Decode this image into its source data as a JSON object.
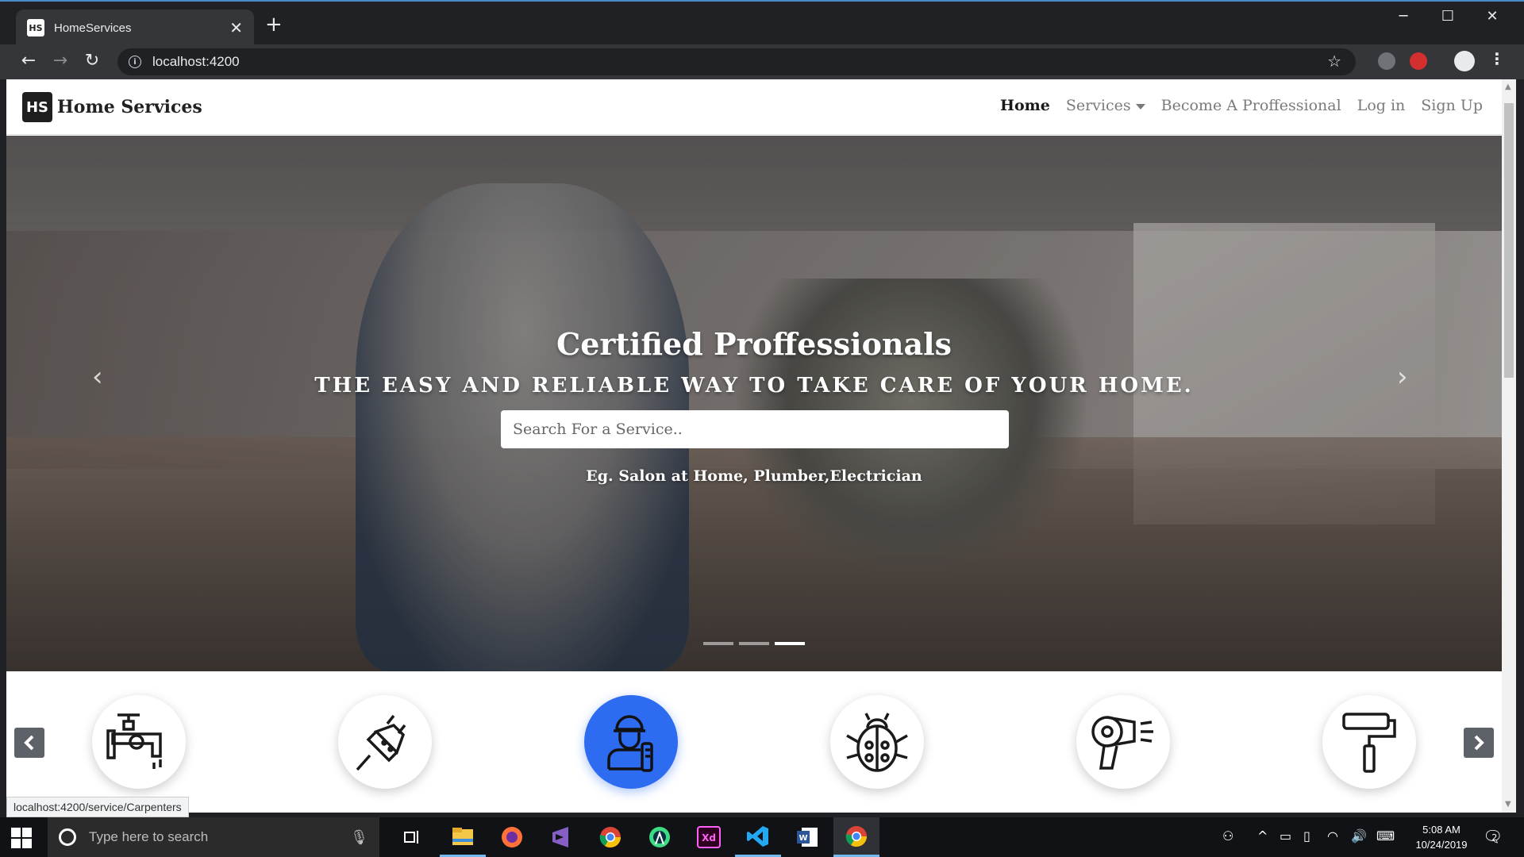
{
  "browser": {
    "tab_favicon": "HS",
    "tab_title": "HomeServices",
    "url": "localhost:4200",
    "status_url": "localhost:4200/service/Carpenters"
  },
  "site": {
    "logo_text": "HS",
    "brand_name": "Home Services",
    "nav": {
      "home": "Home",
      "services": "Services",
      "become_pro": "Become A Proffessional",
      "login": "Log in",
      "signup": "Sign Up"
    }
  },
  "hero": {
    "title": "Certified Proffessionals",
    "subtitle": "THE EASY AND RELIABLE WAY TO TAKE CARE OF YOUR HOME.",
    "search_placeholder": "Search For a Service..",
    "example": "Eg. Salon at Home, Plumber,Electrician",
    "slides_total": 3,
    "active_slide": 3
  },
  "services": {
    "items": [
      "plumber-icon",
      "electrician-icon",
      "carpenter-icon",
      "pest-control-icon",
      "salon-icon",
      "painter-icon"
    ],
    "active_index": 2,
    "active_color": "#2d6bf0"
  },
  "taskbar": {
    "search_placeholder": "Type here to search",
    "time": "5:08 AM",
    "date": "10/24/2019",
    "notifications": "2"
  }
}
